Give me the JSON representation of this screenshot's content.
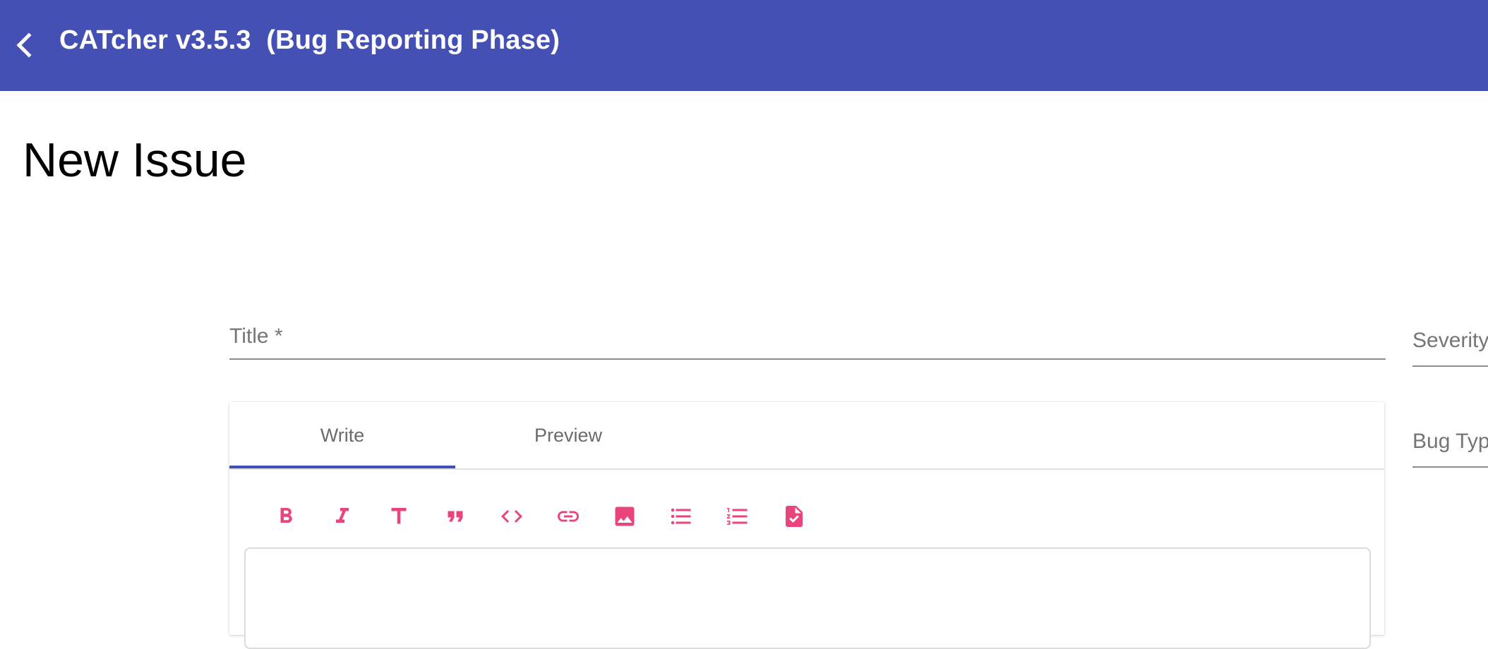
{
  "header": {
    "title": "CATcher v3.5.3  (Bug Reporting Phase)",
    "back_icon": "chevron-left-icon",
    "background_color": "#4450b3"
  },
  "page": {
    "title": "New Issue"
  },
  "form": {
    "title_label": "Title *",
    "severity_label": "Severity",
    "bug_type_label": "Bug Type"
  },
  "editor": {
    "tabs": [
      {
        "label": "Write",
        "active": true
      },
      {
        "label": "Preview",
        "active": false
      }
    ],
    "toolbar": [
      {
        "icon": "bold-icon"
      },
      {
        "icon": "italic-icon"
      },
      {
        "icon": "heading-icon"
      },
      {
        "icon": "quote-icon"
      },
      {
        "icon": "code-icon"
      },
      {
        "icon": "link-icon"
      },
      {
        "icon": "image-icon"
      },
      {
        "icon": "bulleted-list-icon"
      },
      {
        "icon": "numbered-list-icon"
      },
      {
        "icon": "task-file-icon"
      }
    ],
    "accent_color": "#e9457a",
    "tab_ink_color": "#3f51b5"
  }
}
